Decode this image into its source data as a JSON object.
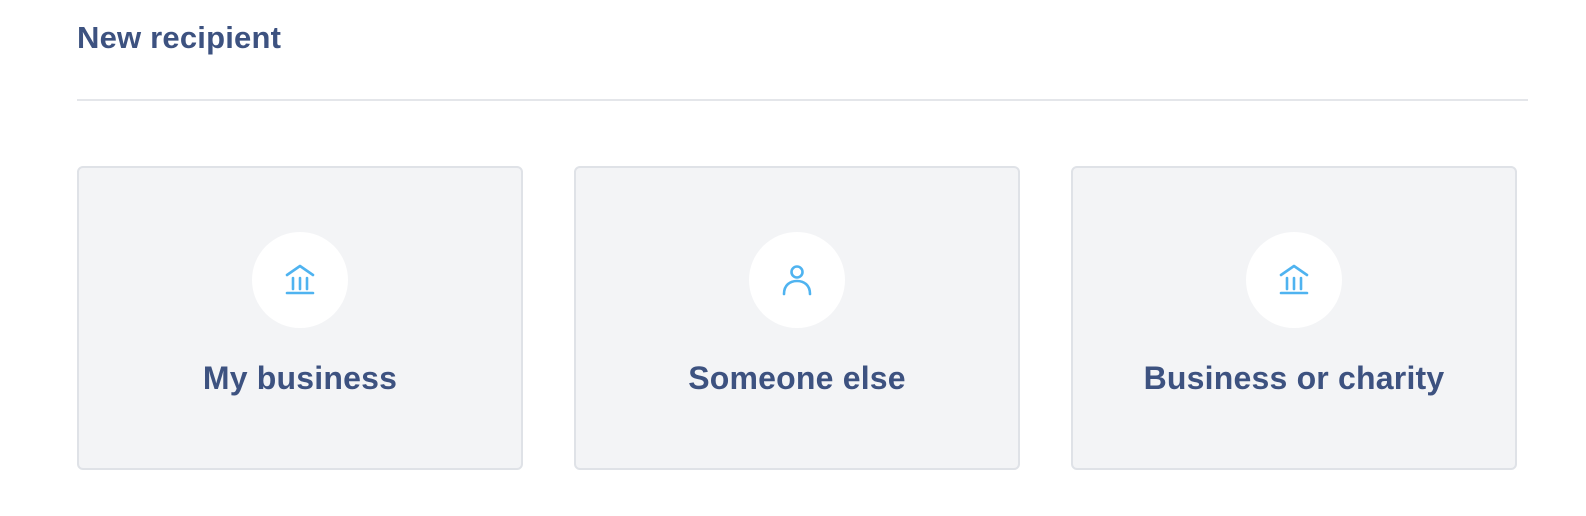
{
  "page": {
    "title": "New recipient"
  },
  "options": [
    {
      "label": "My business",
      "icon": "bank-icon"
    },
    {
      "label": "Someone else",
      "icon": "person-icon"
    },
    {
      "label": "Business or charity",
      "icon": "bank-icon"
    }
  ],
  "colors": {
    "title": "#3d5280",
    "card_background": "#f3f4f6",
    "card_border": "#dfe2e7",
    "icon_accent": "#4fb3f0",
    "divider": "#e4e6ea"
  }
}
